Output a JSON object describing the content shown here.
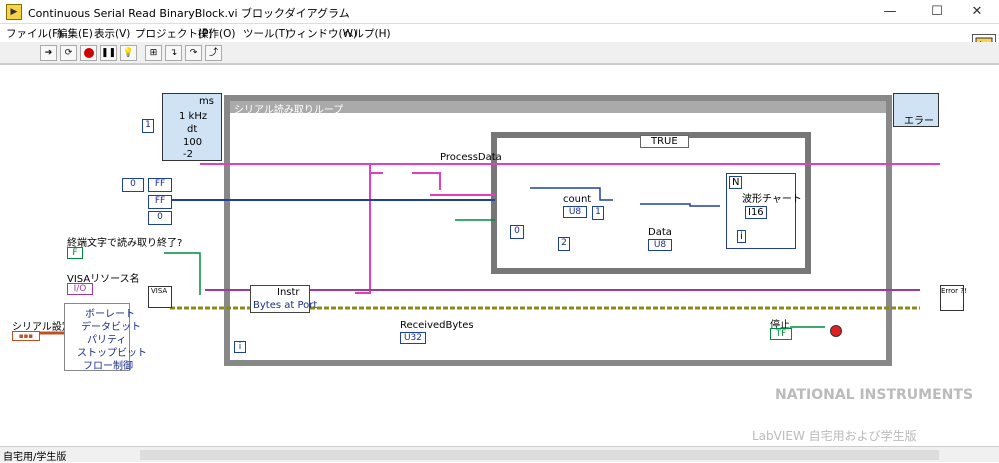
{
  "window": {
    "title": "Continuous Serial Read BinaryBlock.vi ブロックダイアグラム",
    "minimize": "—",
    "maximize": "☐",
    "close": "✕"
  },
  "menu": [
    "ファイル(F)",
    "編集(E)",
    "表示(V)",
    "プロジェクト(P)",
    "操作(O)",
    "ツール(T)",
    "ウィンドウ(W)",
    "ヘルプ(H)"
  ],
  "status": {
    "label": "自宅用/学生版"
  },
  "diagram": {
    "while_loop_label": "シリアル読み取りループ",
    "case_selector": "TRUE",
    "timing_unit": "ms",
    "timing_left": [
      "1 kHz",
      "dt",
      "100",
      "-2"
    ],
    "timing_right": "エラー",
    "const_1": "1",
    "const_0": "0",
    "const_ff1": "FF",
    "const_ff2": "FF",
    "const_0b": "0",
    "process_data_label": "ProcessData",
    "count_label": "count",
    "count_type": "U8",
    "data_label": "Data",
    "data_type": "U8",
    "chart_label": "波形チャート",
    "chart_type": "I16",
    "chart_n": "N",
    "const_0c": "0",
    "const_2": "2",
    "const_1b": "1",
    "termchar_label": "終端文字で読み取り終了?",
    "termchar_val": "F",
    "visa_resource_label": "VISAリソース名",
    "visa_io": "I/O",
    "serial_settings_label": "シリアル設定",
    "cluster_items": [
      "ボーレート",
      "データビット",
      "パリティ",
      "ストップビット",
      "フロー制御"
    ],
    "instr_label": "Instr",
    "bytes_at_port": "Bytes at Port",
    "received_bytes_label": "ReceivedBytes",
    "received_type": "U32",
    "stop_label": "停止",
    "stop_type": "TF",
    "iteration_i": "i",
    "ni_brand": "NATIONAL INSTRUMENTS",
    "labview_brand": "LabVIEW 自宅用および学生版",
    "visa_tag": "VISA",
    "error_tag": "Error ?!",
    "chart_i": "i"
  }
}
